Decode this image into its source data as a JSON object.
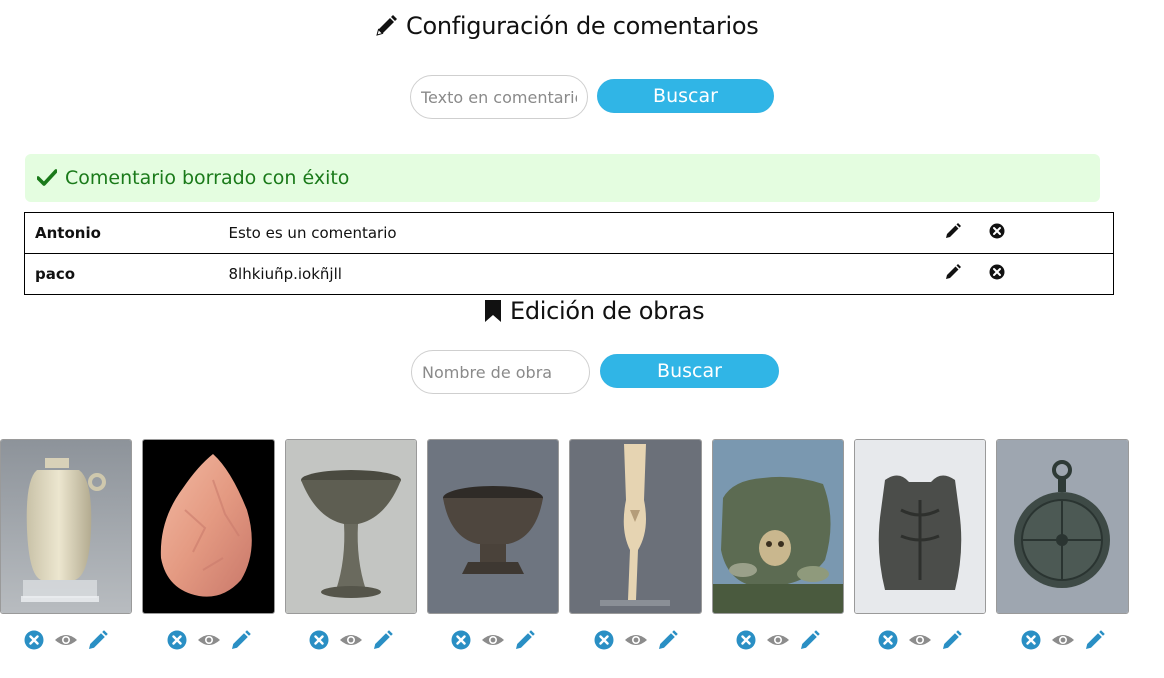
{
  "comments_section": {
    "title": "Configuración de comentarios",
    "search_placeholder": "Texto en comentario",
    "search_button": "Buscar",
    "alert": "Comentario borrado con éxito",
    "rows": [
      {
        "author": "Antonio",
        "text": "Esto es un comentario"
      },
      {
        "author": "paco",
        "text": "8lhkiuñp.iokñjll"
      }
    ]
  },
  "works_section": {
    "title": "Edición de obras",
    "search_placeholder": "Nombre de obra",
    "search_button": "Buscar",
    "items": [
      {
        "image": "alabaster-jar"
      },
      {
        "image": "flint-handaxe"
      },
      {
        "image": "ceramic-chalice"
      },
      {
        "image": "ceramic-bowl-on-foot"
      },
      {
        "image": "ivory-figurine"
      },
      {
        "image": "skull-burial-urn"
      },
      {
        "image": "bronze-cuirass"
      },
      {
        "image": "astrolabe"
      }
    ]
  },
  "colors": {
    "accent": "#30b5e6",
    "icon_blue": "#2a8fc4",
    "icon_gray": "#8c8c8c",
    "alert_bg": "#e4fde0",
    "alert_text": "#1a7a1a"
  }
}
